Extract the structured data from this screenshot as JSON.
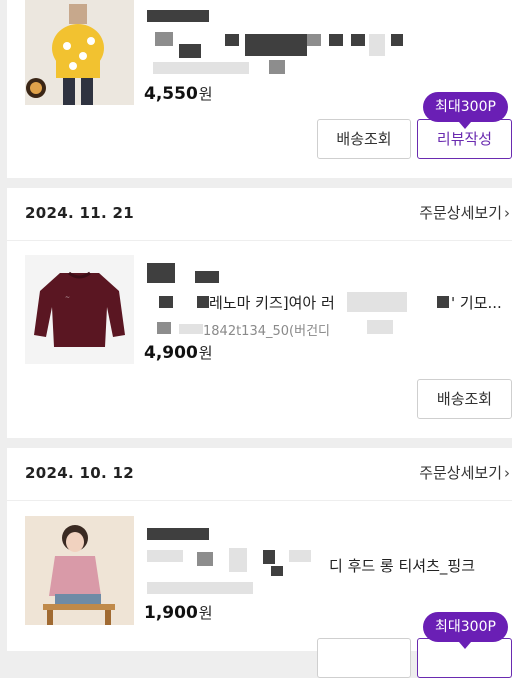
{
  "orders": [
    {
      "price": "4,550",
      "price_unit": "원",
      "buttons": {
        "shipping": "배송조회",
        "review": "리뷰작성"
      },
      "points_badge": "최대300P",
      "colors": {
        "accent": "#6a1fb5"
      }
    },
    {
      "date": "2024. 11. 21",
      "detail_link": "주문상세보기",
      "product_name": "레노마 키즈]여아 러",
      "product_name_tail": "' 기모...",
      "product_option": "1842t134_50(버건디",
      "price": "4,900",
      "price_unit": "원",
      "buttons": {
        "shipping": "배송조회"
      }
    },
    {
      "date": "2024. 10. 12",
      "detail_link": "주문상세보기",
      "product_name_tail": "디 후드 롱 티셔츠_핑크",
      "price": "1,900",
      "price_unit": "원",
      "points_badge": "최대300P"
    }
  ],
  "icons": {
    "chevron": "chevron-right-icon"
  }
}
